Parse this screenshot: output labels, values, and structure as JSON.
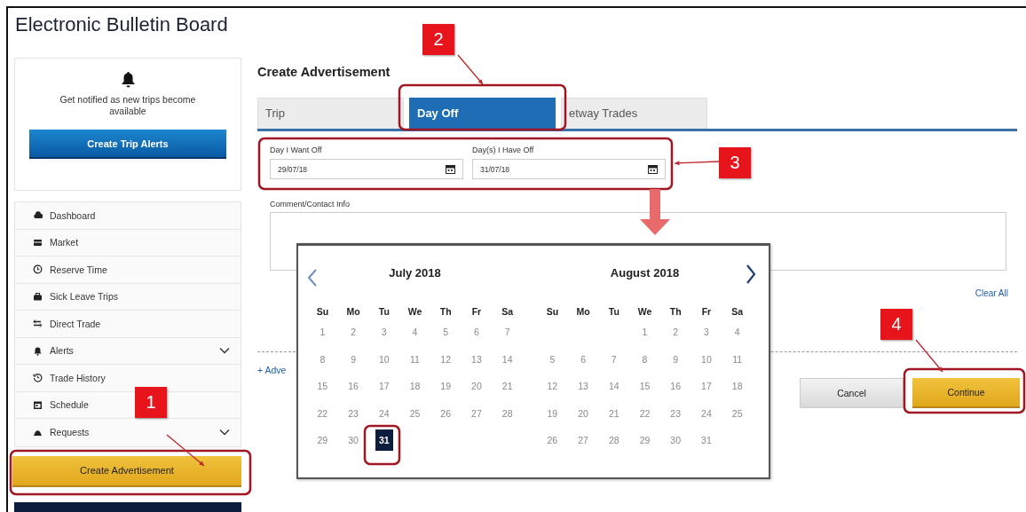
{
  "title": "Electronic Bulletin Board",
  "alert_card": {
    "message": "Get notified as new trips become available",
    "button": "Create Trip Alerts"
  },
  "nav": [
    {
      "label": "Dashboard",
      "expandable": false
    },
    {
      "label": "Market",
      "expandable": false
    },
    {
      "label": "Reserve Time",
      "expandable": false
    },
    {
      "label": "Sick Leave Trips",
      "expandable": false
    },
    {
      "label": "Direct Trade",
      "expandable": false
    },
    {
      "label": "Alerts",
      "expandable": true
    },
    {
      "label": "Trade History",
      "expandable": false
    },
    {
      "label": "Schedule",
      "expandable": false
    },
    {
      "label": "Requests",
      "expandable": true
    }
  ],
  "create_button": "Create Advertisement",
  "form": {
    "heading": "Create Advertisement",
    "tabs": [
      {
        "label": "Trip",
        "selected": false
      },
      {
        "label": "Day Off",
        "selected": true
      },
      {
        "label": "etway Trades",
        "selected": false
      }
    ],
    "fields": [
      {
        "label": "Day I Want Off",
        "value": "29/07/18"
      },
      {
        "label": "Day(s) I Have Off",
        "value": "31/07/18"
      }
    ],
    "comment_label": "Comment/Contact Info",
    "clear_all": "Clear All",
    "add_link": "+ Adve",
    "buttons": [
      {
        "label": "Cancel",
        "kind": "secondary"
      },
      {
        "label": "Continue",
        "kind": "primary"
      }
    ]
  },
  "datepicker": {
    "months": [
      {
        "title": "July 2018",
        "weekdays": [
          "Su",
          "Mo",
          "Tu",
          "We",
          "Th",
          "Fr",
          "Sa"
        ],
        "weeks": [
          [
            {
              "day": "1",
              "selected": false
            },
            {
              "day": "2",
              "selected": false
            },
            {
              "day": "3",
              "selected": false
            },
            {
              "day": "4",
              "selected": false
            },
            {
              "day": "5",
              "selected": false
            },
            {
              "day": "6",
              "selected": false
            },
            {
              "day": "7",
              "selected": false
            }
          ],
          [
            {
              "day": "8",
              "selected": false
            },
            {
              "day": "9",
              "selected": false
            },
            {
              "day": "10",
              "selected": false
            },
            {
              "day": "11",
              "selected": false
            },
            {
              "day": "12",
              "selected": false
            },
            {
              "day": "13",
              "selected": false
            },
            {
              "day": "14",
              "selected": false
            }
          ],
          [
            {
              "day": "15",
              "selected": false
            },
            {
              "day": "16",
              "selected": false
            },
            {
              "day": "17",
              "selected": false
            },
            {
              "day": "18",
              "selected": false
            },
            {
              "day": "19",
              "selected": false
            },
            {
              "day": "20",
              "selected": false
            },
            {
              "day": "21",
              "selected": false
            }
          ],
          [
            {
              "day": "22",
              "selected": false
            },
            {
              "day": "23",
              "selected": false
            },
            {
              "day": "24",
              "selected": false
            },
            {
              "day": "25",
              "selected": false
            },
            {
              "day": "26",
              "selected": false
            },
            {
              "day": "27",
              "selected": false
            },
            {
              "day": "28",
              "selected": false
            }
          ],
          [
            {
              "day": "29",
              "selected": false
            },
            {
              "day": "30",
              "selected": false
            },
            {
              "day": "31",
              "selected": true
            },
            {
              "kind": "empty"
            },
            {
              "kind": "empty"
            },
            {
              "kind": "empty"
            },
            {
              "kind": "empty"
            }
          ]
        ]
      },
      {
        "title": "August 2018",
        "weekdays": [
          "Su",
          "Mo",
          "Tu",
          "We",
          "Th",
          "Fr",
          "Sa"
        ],
        "weeks": [
          [
            {
              "kind": "empty"
            },
            {
              "kind": "empty"
            },
            {
              "kind": "empty"
            },
            {
              "day": "1",
              "selected": false
            },
            {
              "day": "2",
              "selected": false
            },
            {
              "day": "3",
              "selected": false
            },
            {
              "day": "4",
              "selected": false
            }
          ],
          [
            {
              "day": "5",
              "selected": false
            },
            {
              "day": "6",
              "selected": false
            },
            {
              "day": "7",
              "selected": false
            },
            {
              "day": "8",
              "selected": false
            },
            {
              "day": "9",
              "selected": false
            },
            {
              "day": "10",
              "selected": false
            },
            {
              "day": "11",
              "selected": false
            }
          ],
          [
            {
              "day": "12",
              "selected": false
            },
            {
              "day": "13",
              "selected": false
            },
            {
              "day": "14",
              "selected": false
            },
            {
              "day": "15",
              "selected": false
            },
            {
              "day": "16",
              "selected": false
            },
            {
              "day": "17",
              "selected": false
            },
            {
              "day": "18",
              "selected": false
            }
          ],
          [
            {
              "day": "19",
              "selected": false
            },
            {
              "day": "20",
              "selected": false
            },
            {
              "day": "21",
              "selected": false
            },
            {
              "day": "22",
              "selected": false
            },
            {
              "day": "23",
              "selected": false
            },
            {
              "day": "24",
              "selected": false
            },
            {
              "day": "25",
              "selected": false
            }
          ],
          [
            {
              "day": "26",
              "selected": false
            },
            {
              "day": "27",
              "selected": false
            },
            {
              "day": "28",
              "selected": false
            },
            {
              "day": "29",
              "selected": false
            },
            {
              "day": "30",
              "selected": false
            },
            {
              "day": "31",
              "selected": false
            },
            {
              "kind": "empty"
            }
          ]
        ]
      }
    ]
  },
  "callouts": [
    "1",
    "2",
    "3",
    "4"
  ]
}
